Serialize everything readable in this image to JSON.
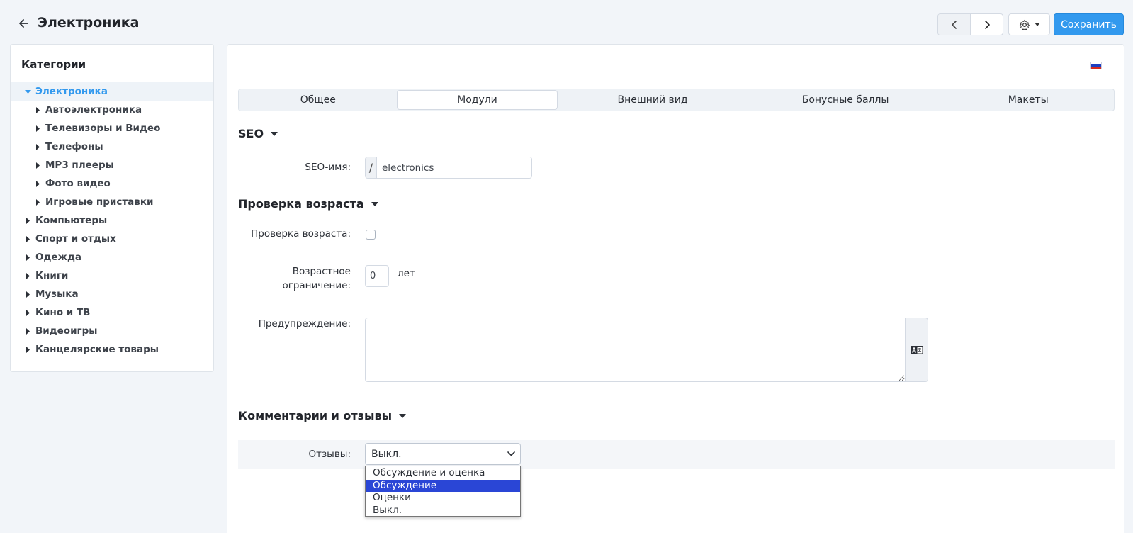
{
  "header": {
    "title": "Электроника",
    "save_label": "Сохранить"
  },
  "sidebar": {
    "title": "Категории",
    "items": [
      {
        "label": "Электроника",
        "level": 0,
        "expanded": true,
        "active": true
      },
      {
        "label": "Автоэлектроника",
        "level": 1
      },
      {
        "label": "Телевизоры и Видео",
        "level": 1
      },
      {
        "label": "Телефоны",
        "level": 1
      },
      {
        "label": "MP3 плееры",
        "level": 1
      },
      {
        "label": "Фото видео",
        "level": 1
      },
      {
        "label": "Игровые приставки",
        "level": 1
      },
      {
        "label": "Компьютеры",
        "level": 0
      },
      {
        "label": "Спорт и отдых",
        "level": 0
      },
      {
        "label": "Одежда",
        "level": 0
      },
      {
        "label": "Книги",
        "level": 0
      },
      {
        "label": "Музыка",
        "level": 0
      },
      {
        "label": "Кино и ТВ",
        "level": 0
      },
      {
        "label": "Видеоигры",
        "level": 0
      },
      {
        "label": "Канцелярские товары",
        "level": 0
      }
    ]
  },
  "tabs": [
    {
      "label": "Общее",
      "active": false
    },
    {
      "label": "Модули",
      "active": true
    },
    {
      "label": "Внешний вид",
      "active": false
    },
    {
      "label": "Бонусные баллы",
      "active": false
    },
    {
      "label": "Макеты",
      "active": false
    }
  ],
  "seo": {
    "section_title": "SEO",
    "name_label": "SEO-имя:",
    "prefix": "/",
    "name_value": "electronics"
  },
  "age": {
    "section_title": "Проверка возраста",
    "check_label": "Проверка возраста:",
    "limit_label_line1": "Возрастное",
    "limit_label_line2": "ограничение:",
    "limit_value": "0",
    "limit_unit": "лет",
    "warning_label": "Предупреждение:",
    "warning_value": ""
  },
  "reviews": {
    "section_title": "Комментарии и отзывы",
    "label": "Отзывы:",
    "selected_value": "Выкл.",
    "options": [
      {
        "label": "Обсуждение и оценка",
        "highlighted": false
      },
      {
        "label": "Обсуждение",
        "highlighted": true
      },
      {
        "label": "Оценки",
        "highlighted": false
      },
      {
        "label": "Выкл.",
        "highlighted": false
      }
    ]
  },
  "colors": {
    "accent": "#3299ee",
    "highlight": "#2a46d6",
    "flag": [
      "#ffffff",
      "#1c3fc0",
      "#d52b1e"
    ]
  }
}
